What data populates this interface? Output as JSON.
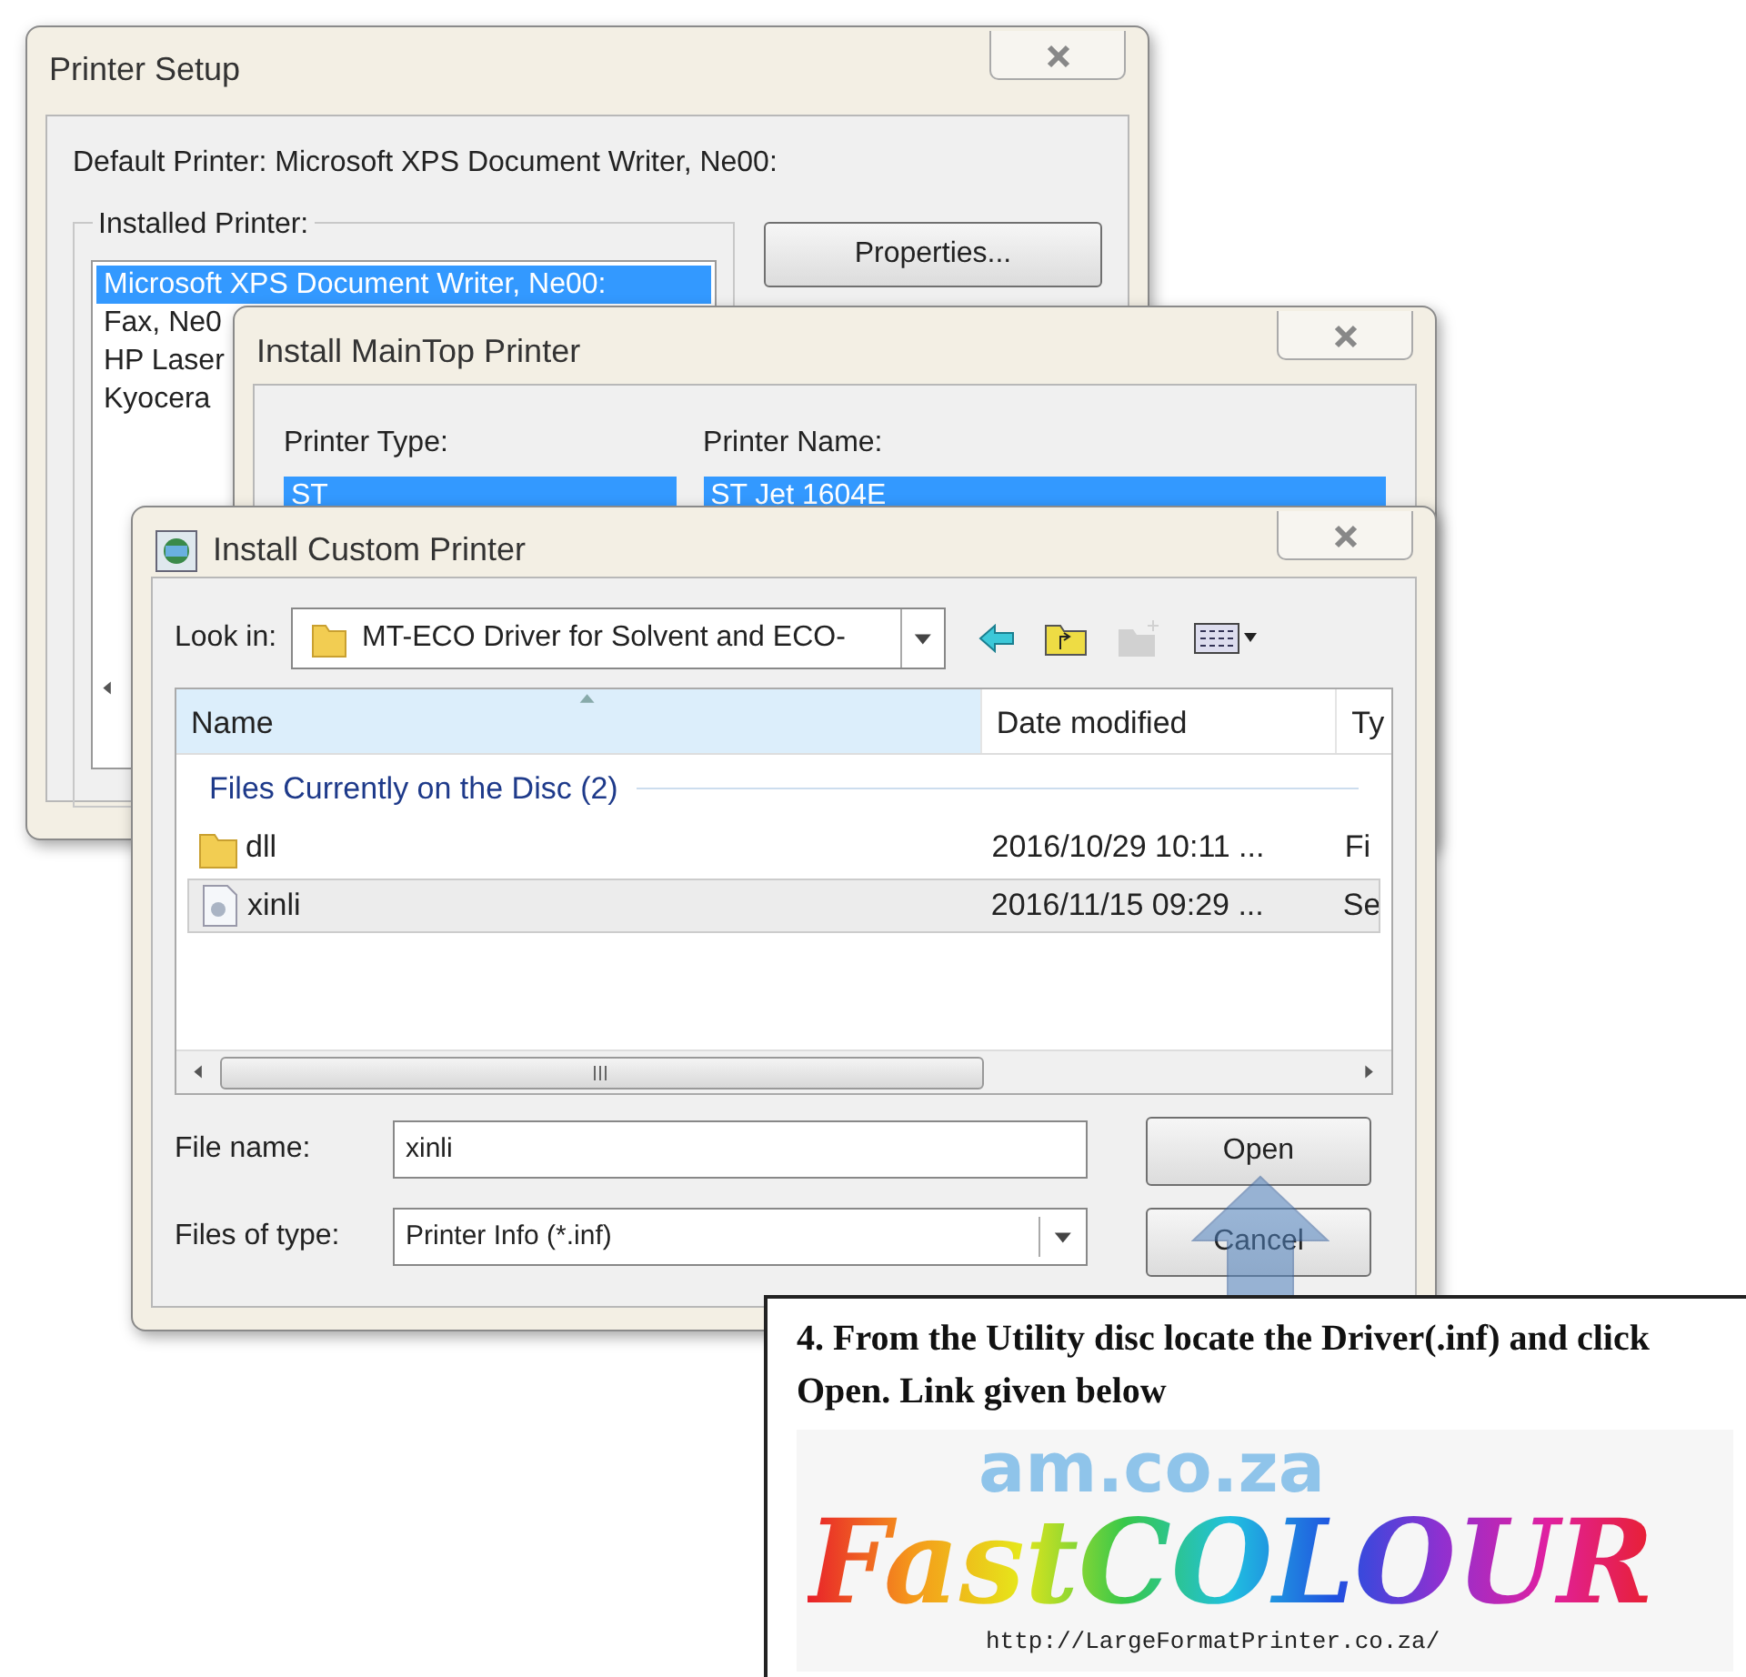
{
  "printer_setup": {
    "title": "Printer Setup",
    "default_printer": "Default Printer: Microsoft XPS Document Writer, Ne00:",
    "group_label": "Installed Printer:",
    "printers": [
      {
        "name": "Microsoft XPS Document Writer, Ne00:",
        "selected": true
      },
      {
        "name": "Fax, Ne0",
        "selected": false
      },
      {
        "name": "HP Laser",
        "selected": false
      },
      {
        "name": "Kyocera",
        "selected": false
      }
    ],
    "buttons": [
      "Properties..."
    ]
  },
  "install_maintop": {
    "title": "Install MainTop Printer",
    "columns": [
      "Printer Type:",
      "Printer Name:"
    ],
    "selected_row": [
      "ST",
      "ST Jet 1604E"
    ]
  },
  "install_custom": {
    "title": "Install Custom Printer",
    "look_in_label": "Look in:",
    "look_in": "MT-ECO Driver for Solvent and ECO-",
    "toolbar": [
      {
        "kind": "back",
        "disabled": false
      },
      {
        "kind": "up",
        "disabled": false
      },
      {
        "kind": "newfolder",
        "disabled": true
      },
      {
        "kind": "views",
        "disabled": false
      }
    ],
    "columns": [
      {
        "label": "Name",
        "sorted": true
      },
      {
        "label": "Date modified",
        "sorted": false
      },
      {
        "label": "Ty",
        "sorted": false
      }
    ],
    "group": "Files Currently on the Disc (2)",
    "files": [
      {
        "kind": "folder",
        "name": "dll",
        "date": "2016/10/29 10:11 ...",
        "type": "Fi",
        "selected": false
      },
      {
        "kind": "file",
        "name": "xinli",
        "date": "2016/11/15 09:29 ...",
        "type": "Se",
        "selected": true
      }
    ],
    "file_name_label": "File name:",
    "file_name": "xinli",
    "type_label": "Files of type:",
    "file_type": "Printer Info (*.inf)",
    "buttons": [
      "Open",
      "Cancel"
    ]
  },
  "callout": {
    "text": "4. From the Utility disc locate the Driver(.inf) and click Open. Link given below",
    "tagline": "am.co.za",
    "logo": "FastCOLOUR",
    "url": "http://LargeFormatPrinter.co.za/"
  }
}
